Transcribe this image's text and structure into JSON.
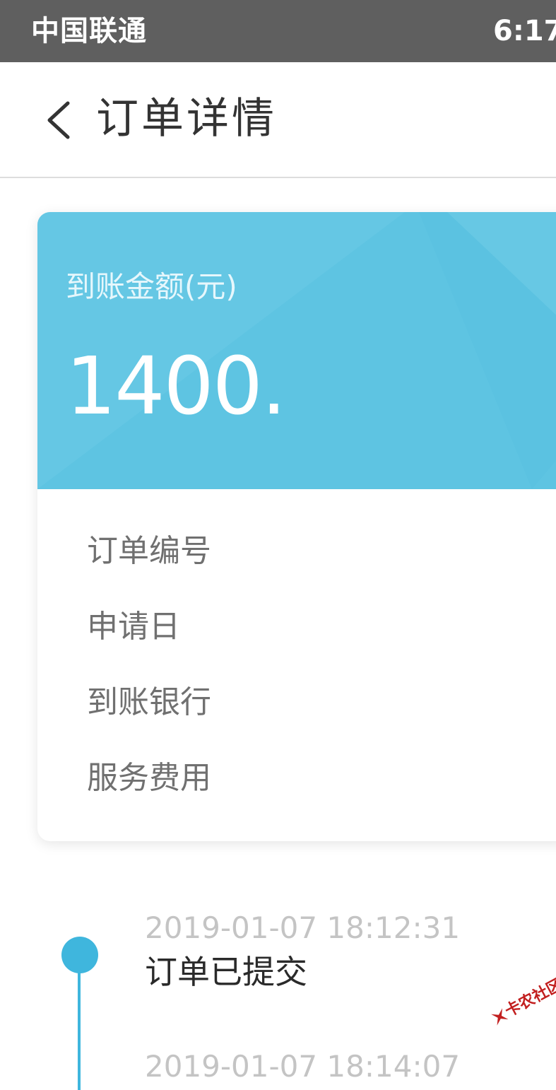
{
  "status_bar": {
    "carrier": "中国联通",
    "time": "6:17"
  },
  "nav": {
    "back_icon": "chevron-left-icon",
    "title": "订单详情"
  },
  "card": {
    "header_color": "#5ec4e2",
    "amount_label": "到账金额(元)",
    "amount_value": "1400.",
    "details": [
      {
        "label": "订单编号"
      },
      {
        "label": "申请日"
      },
      {
        "label": "到账银行"
      },
      {
        "label": "服务费用"
      }
    ]
  },
  "timeline": {
    "accent_color": "#3fb6dd",
    "events": [
      {
        "time": "2019-01-07 18:12:31",
        "title": "订单已提交"
      },
      {
        "time": "2019-01-07 18:14:07",
        "title": ""
      }
    ]
  },
  "watermark": {
    "text": "卡农社区"
  }
}
